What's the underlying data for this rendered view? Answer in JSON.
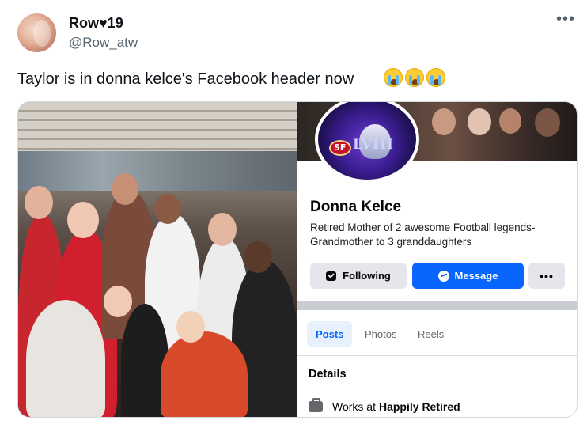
{
  "tweet": {
    "display_name": "Row♥19",
    "handle": "@Row_atw",
    "text": "Taylor is in donna kelce's Facebook header now",
    "emoji": [
      "loudly-crying-face",
      "loudly-crying-face",
      "loudly-crying-face"
    ],
    "more_label": "•••"
  },
  "facebook": {
    "name": "Donna Kelce",
    "bio_line1": "Retired Mother of 2 awesome Football legends-",
    "bio_line2": "Grandmother to 3 granddaughters",
    "buttons": {
      "following": "Following",
      "message": "Message",
      "more": "•••"
    },
    "tabs": [
      "Posts",
      "Photos",
      "Reels"
    ],
    "details_heading": "Details",
    "work_prefix": "Works at",
    "work_place": "Happily Retired",
    "colors": {
      "message_blue": "#0866ff",
      "tab_active_text": "#0866ff",
      "button_gray": "#e4e6eb"
    }
  }
}
